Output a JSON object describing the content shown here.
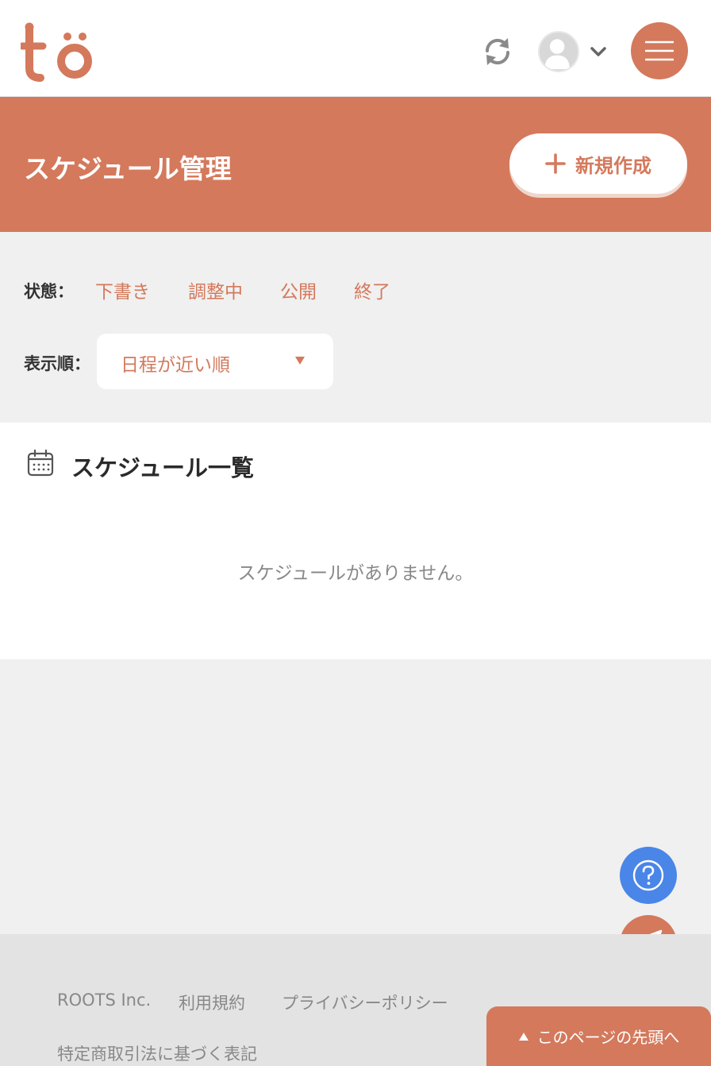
{
  "colors": {
    "accent": "#d4795c",
    "help_button": "#4a86e8",
    "background": "#f0f0f0",
    "footer_background": "#e3e3e3"
  },
  "header": {
    "logo_text": "to",
    "icons": [
      "sync-icon",
      "avatar",
      "chevron-down-icon",
      "hamburger-menu-icon"
    ]
  },
  "banner": {
    "title": "スケジュール管理",
    "new_button_label": "新規作成"
  },
  "filters": {
    "status_label": "状態：",
    "status_options": [
      "下書き",
      "調整中",
      "公開",
      "終了"
    ],
    "sort_label": "表示順：",
    "sort_value": "日程が近い順"
  },
  "list": {
    "title": "スケジュール一覧",
    "empty_message": "スケジュールがありません。"
  },
  "fabs": {
    "help_icon": "question-icon",
    "send_icon": "paper-plane-icon"
  },
  "footer": {
    "links": [
      "ROOTS Inc.",
      "利用規約",
      "プライバシーポリシー",
      "特定商取引法に基づく表記"
    ],
    "to_top_label": "このページの先頭へ"
  }
}
